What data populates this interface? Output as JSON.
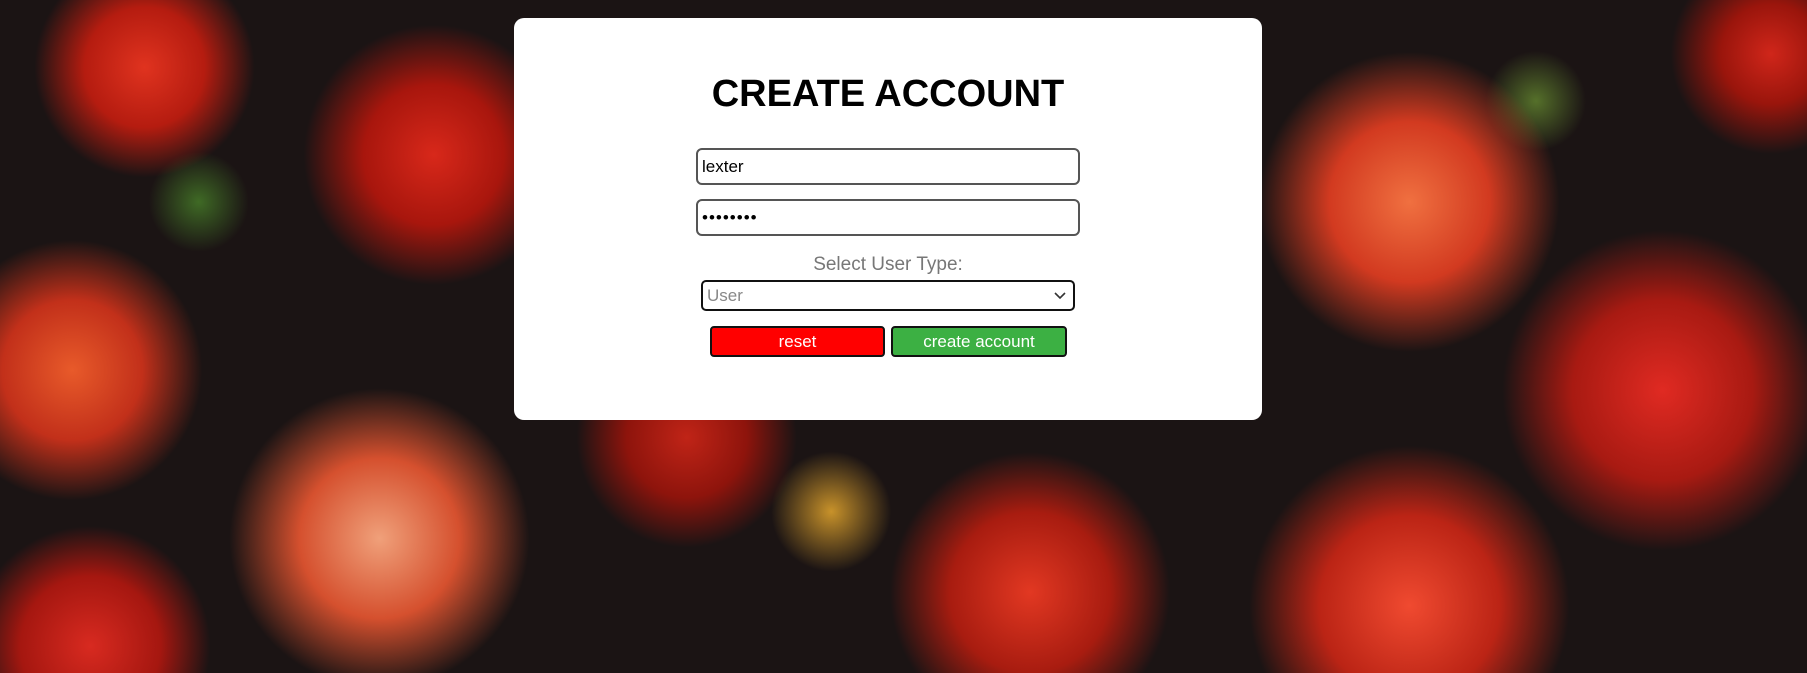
{
  "form": {
    "title": "CREATE ACCOUNT",
    "username_value": "lexter",
    "password_value": "password",
    "select_label": "Select User Type:",
    "user_type_selected": "User",
    "reset_label": "reset",
    "create_label": "create account"
  },
  "colors": {
    "reset_button": "#ff0000",
    "create_button": "#3cb043",
    "card": "#ffffff"
  },
  "icons": {
    "select_chevron": "chevron-down-icon"
  }
}
